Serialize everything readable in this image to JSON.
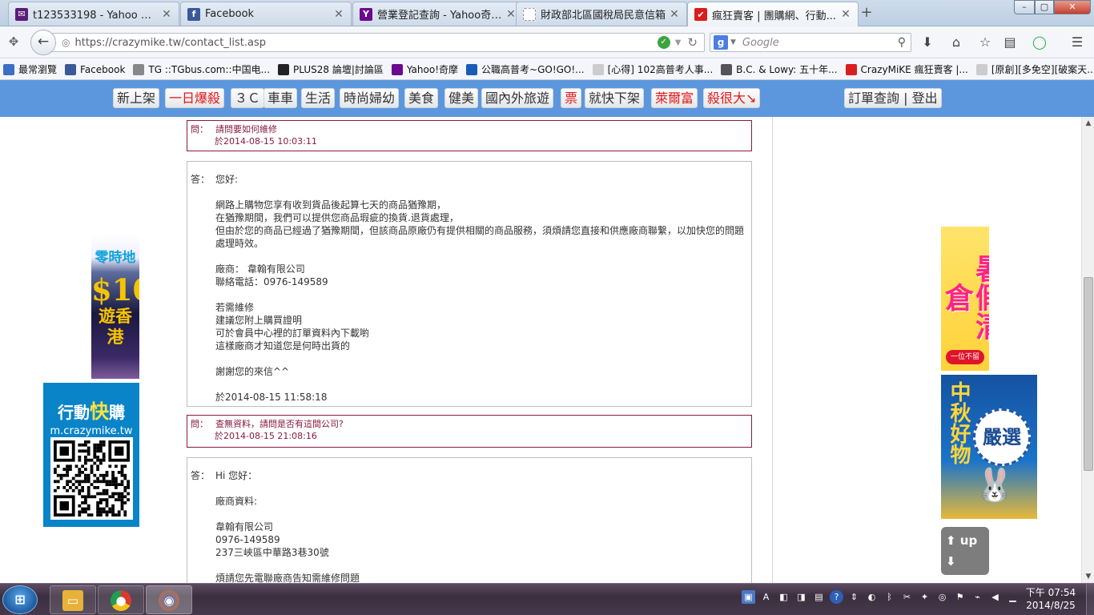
{
  "browser": {
    "tabs": [
      {
        "title": "t123533198 - Yahoo 奇摩...",
        "icon": "yahoo-mail-icon",
        "color": "#5b1c7a",
        "glyph": "✉"
      },
      {
        "title": "Facebook",
        "icon": "facebook-icon",
        "color": "#3b5998",
        "glyph": "f"
      },
      {
        "title": "營業登記查詢 - Yahoo奇摩 搜...",
        "icon": "yahoo-search-icon",
        "color": "#6b0a8c",
        "glyph": "Y"
      },
      {
        "title": "財政部北區國稅局民意信箱",
        "icon": "page-icon",
        "color": "#ffffff",
        "glyph": ""
      },
      {
        "title": "瘋狂賣客 | 團購網、行動...",
        "icon": "crazymike-icon",
        "color": "#d81e1e",
        "glyph": "✔"
      }
    ],
    "new_tab": "+",
    "url": "https://crazymike.tw/contact_list.asp",
    "search_placeholder": "Google",
    "search_engine": "g"
  },
  "bookmarks": [
    {
      "label": "最常瀏覽",
      "color": "#3d6fc4"
    },
    {
      "label": "Facebook",
      "color": "#3b5998"
    },
    {
      "label": "TG ::TGbus.com::中国电...",
      "color": "#888888"
    },
    {
      "label": "PLUS28 論壇|討論區",
      "color": "#222222"
    },
    {
      "label": "Yahoo!奇摩",
      "color": "#6b0a8c"
    },
    {
      "label": "公職高普考~GO!GO!...",
      "color": "#1a5bb5"
    },
    {
      "label": "[心得] 102高普考人事...",
      "color": "#cccccc"
    },
    {
      "label": "B.C. & Lowy: 五十年...",
      "color": "#555555"
    },
    {
      "label": "CrazyMiKE 瘋狂賣客 |...",
      "color": "#d81e1e"
    },
    {
      "label": "[原創][多免空][破案天...",
      "color": "#cccccc"
    }
  ],
  "site_nav": {
    "left": [
      {
        "label": "新上架",
        "red": false
      },
      {
        "label": "一日爆殺",
        "red": true
      },
      {
        "label": "３Ｃ",
        "red": false
      },
      {
        "label": "車車",
        "red": false
      },
      {
        "label": "生活",
        "red": false
      },
      {
        "label": "時尚婦幼",
        "red": false
      },
      {
        "label": "美食",
        "red": false
      },
      {
        "label": "健美",
        "red": false
      },
      {
        "label": "國內外旅遊",
        "red": false
      },
      {
        "label": "票",
        "red": true
      },
      {
        "label": "就快下架",
        "red": false
      },
      {
        "label": "萊爾富",
        "red": true
      },
      {
        "label": "殺很大↘",
        "red": true
      }
    ],
    "account": "訂單查詢 | 登出"
  },
  "messages": {
    "q_label": "問：",
    "a_label": "答：",
    "q1_text": "請問要如何維修",
    "q1_date": "於2014-08-15 10:03:11",
    "a1_text": "您好:\n\n網路上購物您享有收到貨品後起算七天的商品猶豫期，\n在猶豫期間，我們可以提供您商品瑕疵的換貨.退貨處理，\n但由於您的商品已經過了猶豫期間，但該商品原廠仍有提供相關的商品服務，須煩請您直接和供應廠商聯繫，以加快您的問題處理時效。\n\n廠商： 韋翰有限公司\n聯絡電話：0976-149589\n\n若需維修\n建議您附上購買證明\n可於會員中心裡的訂單資料內下載喲\n這樣廠商才知道您是何時出貨的\n\n謝謝您的來信^^\n\n於2014-08-15 11:58:18",
    "q2_text": "查無資料，請問是否有這間公司?",
    "q2_date": "於2014-08-15 21:08:16",
    "a2_text": "Hi 您好：\n\n廠商資料:\n\n韋翰有限公司\n0976-149589\n237三峽區中華路3巷30號\n\n煩請您先電聯廠商告知需維修問題"
  },
  "ads": {
    "hk_brand": "零時地",
    "hk_price": "$10",
    "hk_text": "遊香港",
    "qr_title_a": "行動",
    "qr_title_b": "快",
    "qr_title_c": "購",
    "qr_url": "m.crazymike.tw",
    "summer_text": "暑假清倉",
    "summer_tag": "一位不留",
    "moon_text": "中秋好物",
    "moon_select": "嚴選",
    "up": "up",
    "down": "down"
  },
  "taskbar": {
    "time": "下午 07:54",
    "date": "2014/8/25"
  }
}
